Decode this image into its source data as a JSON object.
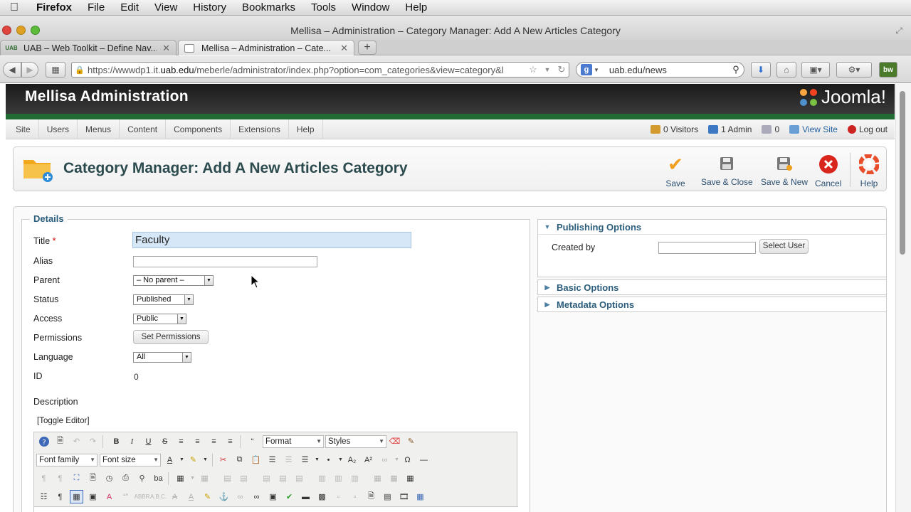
{
  "menubar": {
    "app": "Firefox",
    "items": [
      "File",
      "Edit",
      "View",
      "History",
      "Bookmarks",
      "Tools",
      "Window",
      "Help"
    ]
  },
  "window": {
    "title": "Mellisa – Administration – Category Manager: Add A New Articles Category"
  },
  "tabs": [
    {
      "label": "UAB – Web Toolkit – Define Nav...",
      "favicon": "UAB"
    },
    {
      "label": "Mellisa – Administration – Cate...",
      "favicon": ""
    }
  ],
  "browser": {
    "url_prefix": "https://wwwdp1.it.",
    "url_domain": "uab.edu",
    "url_suffix": "/meberle/administrator/index.php?option=com_categories&view=category&l",
    "search_value": "uab.edu/news",
    "addon_label": "bw"
  },
  "joomla": {
    "site_name": "Mellisa Administration",
    "logo_text": "Joomla!",
    "menu": [
      "Site",
      "Users",
      "Menus",
      "Content",
      "Components",
      "Extensions",
      "Help"
    ],
    "status": {
      "visitors": "0 Visitors",
      "admins": "1 Admin",
      "messages": "0",
      "view_site": "View Site",
      "logout": "Log out"
    },
    "page_title": "Category Manager: Add A New Articles Category",
    "toolbar": {
      "save": "Save",
      "save_close": "Save & Close",
      "save_new": "Save & New",
      "cancel": "Cancel",
      "help": "Help"
    }
  },
  "details": {
    "legend": "Details",
    "title_label": "Title",
    "required_mark": "*",
    "title_value": "Faculty",
    "alias_label": "Alias",
    "alias_value": "",
    "parent_label": "Parent",
    "parent_value": "– No parent –",
    "status_label": "Status",
    "status_value": "Published",
    "access_label": "Access",
    "access_value": "Public",
    "permissions_label": "Permissions",
    "permissions_button": "Set Permissions",
    "language_label": "Language",
    "language_value": "All",
    "id_label": "ID",
    "id_value": "0",
    "description_label": "Description",
    "toggle_editor": "[Toggle Editor]"
  },
  "editor": {
    "format": "Format",
    "styles": "Styles",
    "font_family": "Font family",
    "font_size": "Font size"
  },
  "side": {
    "publishing": "Publishing Options",
    "created_by_label": "Created by",
    "created_by_value": "",
    "select_user": "Select User",
    "basic": "Basic Options",
    "metadata": "Metadata Options"
  },
  "colors": {
    "joomla_green": "#236b35",
    "title_blue": "#2c4b4e",
    "legend_blue": "#2b5d7c",
    "title_input_bg": "#d6e8f7"
  }
}
